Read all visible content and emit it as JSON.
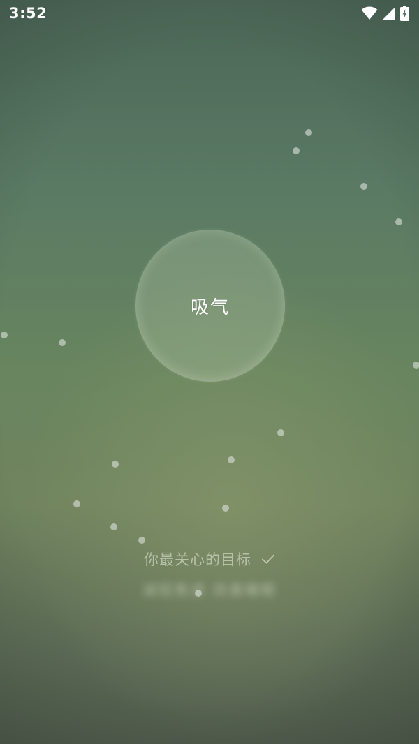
{
  "status_bar": {
    "time": "3:52",
    "icons": [
      "wifi-icon",
      "cellular-signal-icon",
      "battery-charging-icon"
    ]
  },
  "breathing": {
    "label": "吸气"
  },
  "goal": {
    "title": "你最关心的目标",
    "check_icon": "checkmark-icon",
    "subtext": "减轻焦虑 改善睡眠"
  },
  "colors": {
    "background_top": "#4b6556",
    "background_mid": "#68855f",
    "background_bottom": "#4f5a4b",
    "text_primary": "#ffffff"
  }
}
